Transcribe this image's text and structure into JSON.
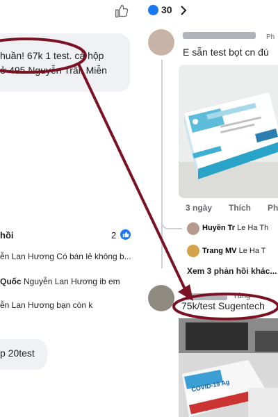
{
  "left": {
    "top_comment": {
      "line1": "huần! 67k 1 test. cả hộp",
      "line2": "ở 495 Nguyễn Trãi. Miễn"
    },
    "replies_header": "hồi",
    "replies_count": "2",
    "replies": [
      {
        "prefix": "",
        "name": "",
        "text": "ễn Lan Hương Có bán lẻ không b..."
      },
      {
        "prefix": "",
        "name": "Quốc",
        "text": "Nguyễn Lan Hương ib em"
      },
      {
        "prefix": "",
        "name": "",
        "text": "ễn Lan Hương bạn còn k"
      }
    ],
    "bottom_comment": "p 20test"
  },
  "right": {
    "likes_count": "30",
    "first_comment": {
      "suffix": "Ph",
      "text": "E sẵn test bọt cn đú"
    },
    "meta": {
      "time": "3 ngày",
      "like": "Thích",
      "reply": "Phả"
    },
    "nested": [
      {
        "name": "Huyền Tr",
        "text": "Le Ha Th"
      },
      {
        "name": "Trang MV",
        "text": "Le Ha T"
      }
    ],
    "more_replies": "Xem 3 phản hồi khác...",
    "second_comment": {
      "suffix": "Tùng",
      "text": "75k/test Sugentech"
    },
    "box_label": "COVID-19 Ag"
  },
  "colors": {
    "annotation": "#7a1224",
    "facebook_blue": "#1877f2",
    "bubble": "#eff1f4"
  },
  "icons": [
    "thumbs-up-icon",
    "chevron-right-icon",
    "like-reaction-icon"
  ]
}
